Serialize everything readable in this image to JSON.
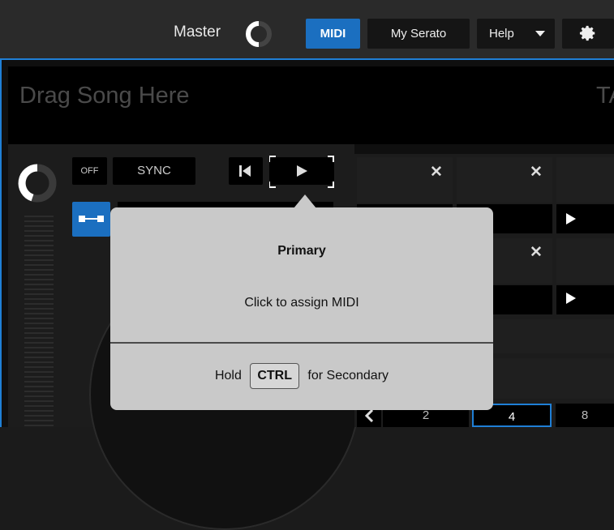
{
  "header": {
    "master_label": "Master",
    "buttons": {
      "midi": "MIDI",
      "my_serato": "My Serato",
      "help": "Help"
    },
    "accent_color": "#1b6fc0"
  },
  "deck": {
    "drag_text": "Drag Song Here",
    "right_text": "TA",
    "off_label": "OFF",
    "sync_label": "SYNC",
    "icons": [
      "gain-knob-icon",
      "prev-track-icon",
      "play-icon",
      "link-icon",
      "close-icon",
      "play-small-icon",
      "chevron-left-icon"
    ]
  },
  "pads": {
    "tabs": [
      "2",
      "4",
      "8"
    ]
  },
  "tooltip": {
    "title": "Primary",
    "body": "Click to assign MIDI",
    "foot_prefix": "Hold",
    "key": "CTRL",
    "foot_suffix": "for Secondary"
  }
}
